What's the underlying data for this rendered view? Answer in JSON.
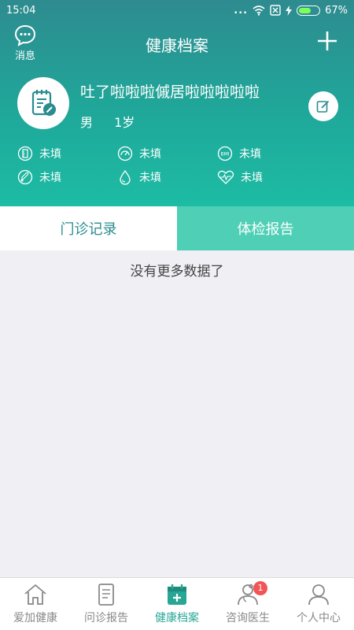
{
  "status_bar": {
    "time": "15:04",
    "dots": "...",
    "battery_level": "67%",
    "battery_fraction": 0.67
  },
  "navbar": {
    "messages_label": "消息",
    "title": "健康档案"
  },
  "profile": {
    "name": "吐了啦啦啦傶居啦啦啦啦啦",
    "gender": "男",
    "age": "1岁"
  },
  "stats": [
    {
      "icon": "height-icon",
      "value": "未填"
    },
    {
      "icon": "gauge-icon",
      "value": "未填"
    },
    {
      "icon": "bmi-icon",
      "value": "未填"
    },
    {
      "icon": "thermometer-icon",
      "value": "未填"
    },
    {
      "icon": "blood-drop-icon",
      "value": "未填"
    },
    {
      "icon": "heart-rate-icon",
      "value": "未填"
    }
  ],
  "stats_bmi_text": "BMI",
  "tabs": [
    {
      "label": "门诊记录",
      "active": true
    },
    {
      "label": "体检报告",
      "active": false
    }
  ],
  "empty_text": "没有更多数据了",
  "bottom_nav": [
    {
      "label": "爱加健康",
      "icon": "home-icon"
    },
    {
      "label": "问诊报告",
      "icon": "report-icon"
    },
    {
      "label": "健康档案",
      "icon": "calendar-plus-icon",
      "active": true
    },
    {
      "label": "咨询医生",
      "icon": "doctor-icon",
      "badge": "1"
    },
    {
      "label": "个人中心",
      "icon": "user-icon"
    }
  ],
  "colors": {
    "accent": "#27a694",
    "header_top": "#2e8b8f",
    "header_bottom": "#1dbca4",
    "tab_inactive": "#4fcfb6",
    "badge": "#f25555"
  }
}
